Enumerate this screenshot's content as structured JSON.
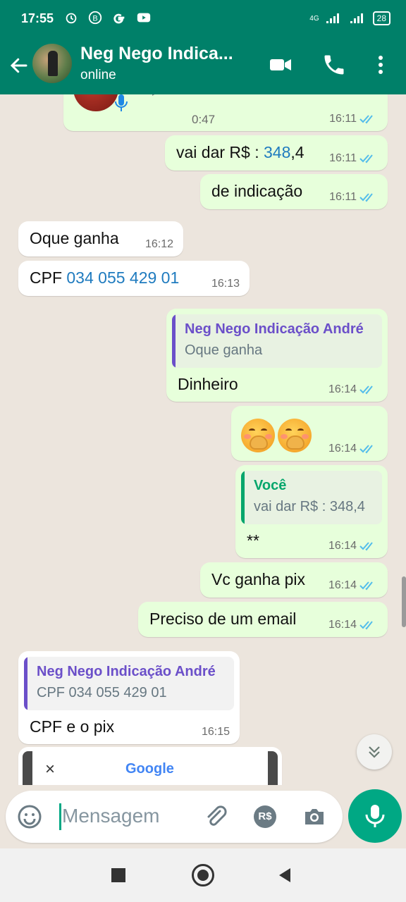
{
  "status_bar": {
    "time": "17:55",
    "signal_label": "4G",
    "battery": "28"
  },
  "header": {
    "contact_name": "Neg Nego Indica...",
    "status": "online"
  },
  "voice_message": {
    "duration": "0:47",
    "time": "16:11"
  },
  "messages": [
    {
      "dir": "out",
      "text_prefix": "vai dar R$ : ",
      "text_link": "348",
      "text_suffix": ",4",
      "time": "16:11"
    },
    {
      "dir": "out",
      "text": "de indicação",
      "time": "16:11"
    },
    {
      "dir": "in",
      "text": "Oque ganha",
      "time": "16:12"
    },
    {
      "dir": "in",
      "text_prefix": "CPF ",
      "text_link": "034 055 429 01",
      "time": "16:13"
    },
    {
      "dir": "out",
      "quote_author": "Neg Nego Indicação André",
      "quote_text": "Oque ganha",
      "text": "Dinheiro",
      "time": "16:14"
    },
    {
      "dir": "out",
      "emoji": "face-with-hand-over-mouth x2",
      "time": "16:14"
    },
    {
      "dir": "out",
      "quote_author": "Você",
      "quote_text": "vai dar R$ : 348,4",
      "text": "**",
      "time": "16:14"
    },
    {
      "dir": "out",
      "text": "Vc ganha pix",
      "time": "16:14"
    },
    {
      "dir": "out",
      "text": "Preciso de um email",
      "time": "16:14"
    },
    {
      "dir": "in",
      "quote_author": "Neg Nego Indicação André",
      "quote_text": "CPF 034 055 429 01",
      "text": "CPF e o pix",
      "time": "16:15"
    }
  ],
  "shared_preview": {
    "close": "×",
    "title": "Google"
  },
  "input": {
    "placeholder": "Mensagem",
    "payment_label": "R$"
  },
  "colors": {
    "header": "#008069",
    "outgoing": "#e7ffdb",
    "incoming": "#ffffff",
    "accent": "#00a884",
    "quote_purple": "#6b4fc9",
    "quote_green": "#06a66c",
    "read_ticks": "#53bdeb"
  }
}
